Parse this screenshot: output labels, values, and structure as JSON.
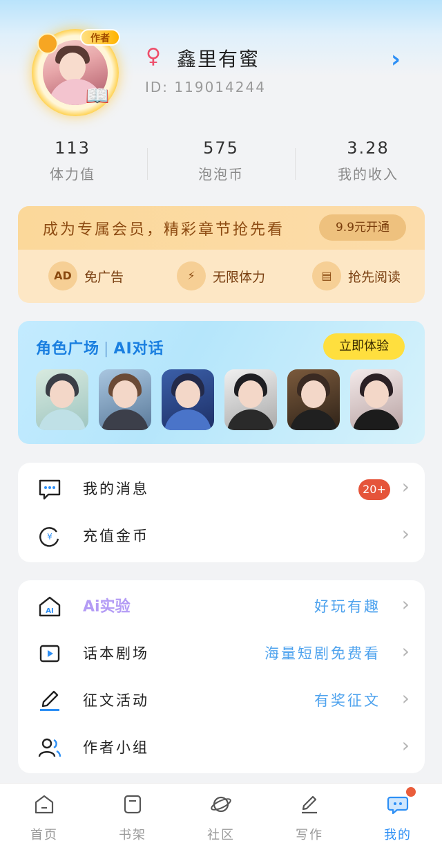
{
  "profile": {
    "author_badge": "作者",
    "gender_symbol": "♀",
    "nickname": "鑫里有蜜",
    "id_text": "ID: 119014244",
    "arrow": "›"
  },
  "stats": [
    {
      "value": "113",
      "label": "体力值"
    },
    {
      "value": "575",
      "label": "泡泡币"
    },
    {
      "value": "3.28",
      "label": "我的收入"
    }
  ],
  "vip": {
    "title": "成为专属会员，精彩章节抢先看",
    "button": "9.9元开通",
    "features": [
      {
        "icon": "AD",
        "label": "免广告"
      },
      {
        "icon": "⚡",
        "label": "无限体力"
      },
      {
        "icon": "▤",
        "label": "抢先阅读"
      }
    ]
  },
  "ai_card": {
    "title_left": "角色广场",
    "separator": "|",
    "title_right": "AI对话",
    "button": "立即体验"
  },
  "menu1": {
    "messages": {
      "label": "我的消息",
      "badge": "20+"
    },
    "recharge": {
      "label": "充值金币"
    }
  },
  "menu2": {
    "ai_lab": {
      "label": "Ai实验",
      "sub": "好玩有趣"
    },
    "theater": {
      "label": "话本剧场",
      "sub": "海量短剧免费看"
    },
    "contest": {
      "label": "征文活动",
      "sub": "有奖征文"
    },
    "group": {
      "label": "作者小组"
    }
  },
  "chevron": "›",
  "tabs": [
    {
      "label": "首页"
    },
    {
      "label": "书架"
    },
    {
      "label": "社区"
    },
    {
      "label": "写作"
    },
    {
      "label": "我的"
    }
  ],
  "colors": {
    "accent": "#2d8ff5",
    "badge": "#e5543a",
    "vip_bg": "#fde7c5",
    "ai_button": "#ffdf3e"
  }
}
